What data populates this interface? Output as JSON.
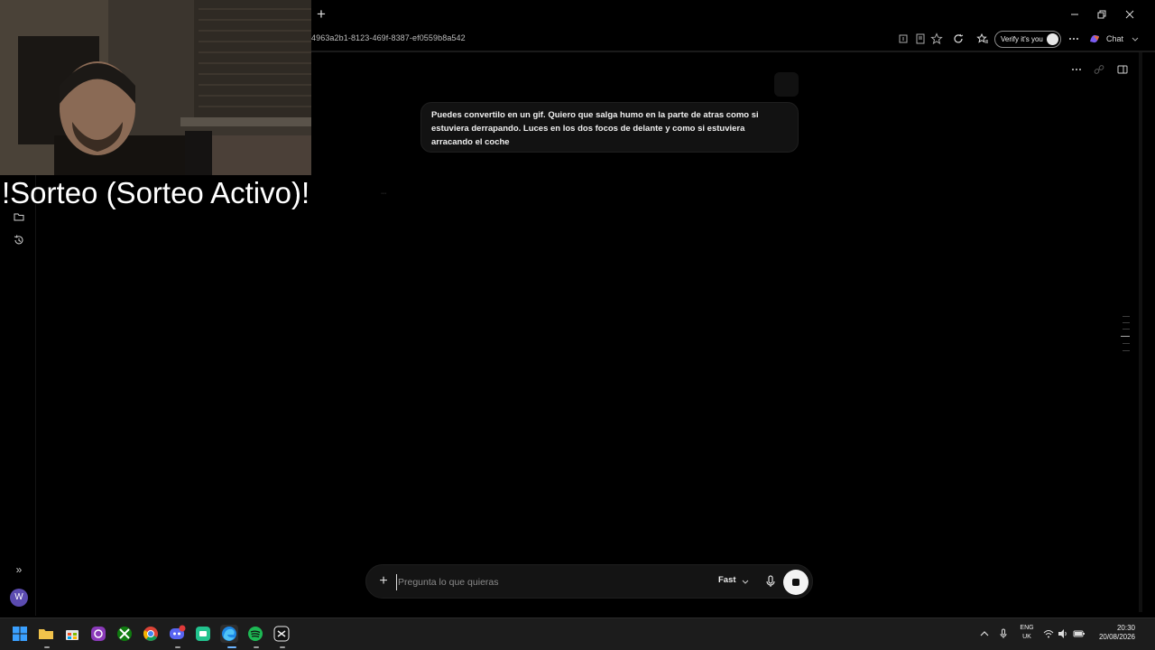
{
  "browser": {
    "url_text": "4963a2b1-8123-469f-8387-ef0559b8a542",
    "verify_label": "Verify it's you",
    "chat_label": "Chat",
    "new_tab_icon": "plus-icon",
    "window_controls": [
      "minimize-icon",
      "restore-icon",
      "close-icon"
    ]
  },
  "conversation": {
    "user_message": "Puedes convertilo en un gif. Quiero que salga humo en la parte de atras como si estuviera derrapando. Luces en los dos focos de delante y como si estuviera arracando el coche"
  },
  "composer": {
    "placeholder": "Pregunta lo que quieras",
    "model_label": "Fast",
    "plus_icon": "plus-icon",
    "mic_icon": "mic-icon",
    "stop_icon": "stop-icon"
  },
  "sidebar": {
    "expand_label": "»",
    "avatar_initial": "W"
  },
  "overlay": {
    "giveaway_text": "!Sorteo (Sorteo Activo)!"
  },
  "taskbar": {
    "lang_line1": "ENG",
    "lang_line2": "UK",
    "time": "20:30",
    "date": "20/08/2026"
  },
  "colors": {
    "background": "#000000",
    "bubble": "#121212",
    "composer": "#141414",
    "taskbar": "#1c1c1c",
    "avatar": "#5b4bb0"
  }
}
